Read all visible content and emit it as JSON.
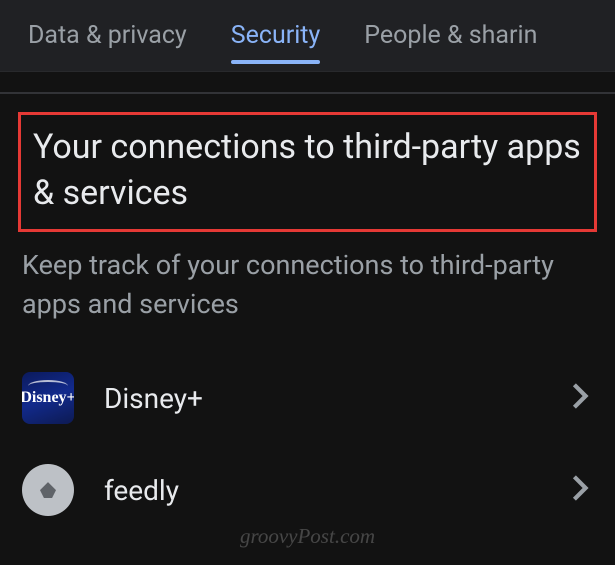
{
  "tabs": {
    "data_privacy": "Data & privacy",
    "security": "Security",
    "people_sharing": "People & sharin"
  },
  "section": {
    "title": "Your connections to third-party apps & services",
    "subtitle": "Keep track of your connections to third-party apps and services"
  },
  "apps": [
    {
      "name": "Disney+",
      "icon": "disney"
    },
    {
      "name": "feedly",
      "icon": "feedly"
    }
  ],
  "watermark": "groovyPost.com"
}
